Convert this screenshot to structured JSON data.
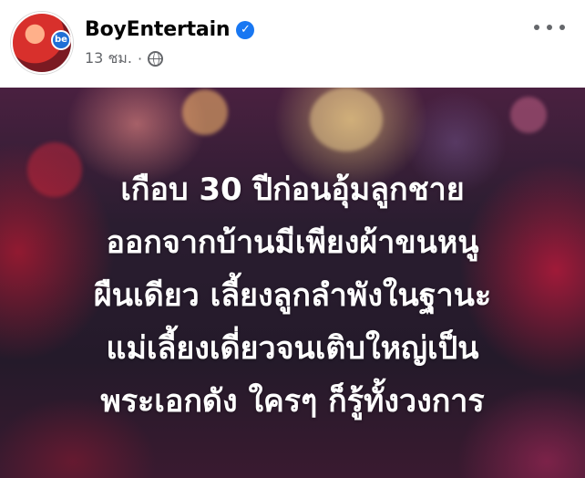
{
  "post": {
    "page_name": "BoyEntertain",
    "avatar_badge": "be",
    "verified_icon": "verified-badge-icon",
    "timestamp": "13 ชม.",
    "separator": "·",
    "audience_icon": "globe-icon",
    "more_icon": "more-options-icon"
  },
  "image": {
    "lines": [
      "เกือบ 30 ปีก่อนอุ้มลูกชาย",
      "ออกจากบ้านมีเพียงผ้าขนหนู",
      "ผืนเดียว เลี้ยงลูกลำพังในฐานะ",
      "แม่เลี้ยงเดี่ยวจนเติบใหญ่เป็น",
      "พระเอกดัง ใครๆ ก็รู้ทั้งวงการ"
    ]
  },
  "colors": {
    "verified": "#1877f2",
    "meta_text": "#65676b",
    "name_text": "#050505"
  }
}
